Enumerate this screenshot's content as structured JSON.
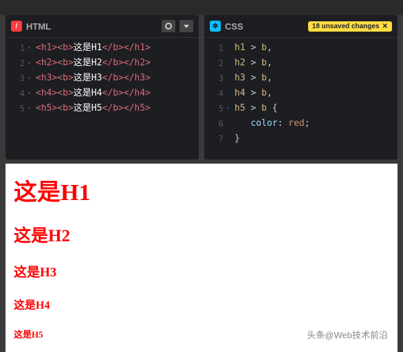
{
  "panels": {
    "html": {
      "title": "HTML",
      "lines": [
        {
          "n": "1",
          "open": "<h1><b>",
          "text": "这是H1",
          "close": "</b></h1>"
        },
        {
          "n": "2",
          "open": "<h2><b>",
          "text": "这是H2",
          "close": "</b></h2>"
        },
        {
          "n": "3",
          "open": "<h3><b>",
          "text": "这是H3",
          "close": "</b></h3>"
        },
        {
          "n": "4",
          "open": "<h4><b>",
          "text": "这是H4",
          "close": "</b></h4>"
        },
        {
          "n": "5",
          "open": "<h5><b>",
          "text": "这是H5",
          "close": "</b></h5>"
        }
      ]
    },
    "css": {
      "title": "CSS",
      "badge": "18 unsaved changes",
      "badge_x": "✕",
      "lines": [
        {
          "n": "1",
          "sel": "h1",
          "op": " > ",
          "sel2": "b",
          "tail": ","
        },
        {
          "n": "2",
          "sel": "h2",
          "op": " > ",
          "sel2": "b",
          "tail": ","
        },
        {
          "n": "3",
          "sel": "h3",
          "op": " > ",
          "sel2": "b",
          "tail": ","
        },
        {
          "n": "4",
          "sel": "h4",
          "op": " > ",
          "sel2": "b",
          "tail": ","
        },
        {
          "n": "5",
          "sel": "h5",
          "op": " > ",
          "sel2": "b",
          "tail": " {"
        },
        {
          "n": "6",
          "prop": "color",
          "colon": ": ",
          "val": "red",
          "semi": ";"
        },
        {
          "n": "7",
          "brace": "}"
        }
      ]
    }
  },
  "preview": {
    "h1": "这是H1",
    "h2": "这是H2",
    "h3": "这是H3",
    "h4": "这是H4",
    "h5": "这是H5"
  },
  "watermark": "头条@Web技术前沿"
}
